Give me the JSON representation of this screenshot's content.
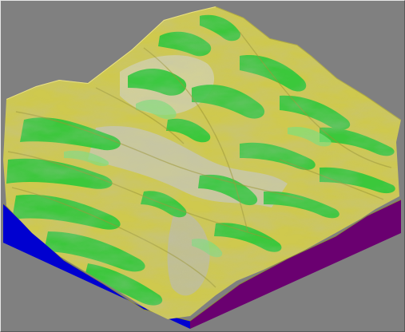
{
  "scene": {
    "background_color": "#808080",
    "colors": {
      "side_left": "#0000d0",
      "side_right": "#6a0070",
      "grass": "#2fc83a",
      "grass_light": "#6fe06a",
      "sand": "#d9d050",
      "sand_dark": "#a9a23a",
      "rock": "#b9b9a8"
    }
  }
}
